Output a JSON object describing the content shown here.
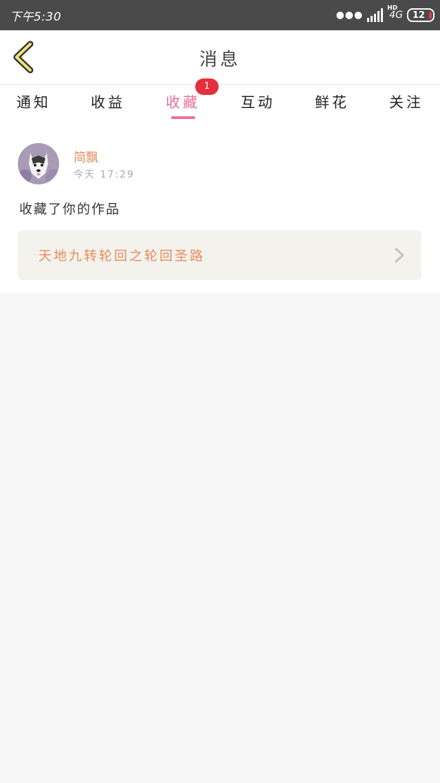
{
  "status_bar": {
    "time": "下午5:30",
    "hd_label": "HD",
    "network_label": "4G",
    "battery": "12"
  },
  "header": {
    "title": "消息"
  },
  "tabs": [
    {
      "label": "通知"
    },
    {
      "label": "收益"
    },
    {
      "label": "收藏",
      "active": true,
      "badge": "1"
    },
    {
      "label": "互动"
    },
    {
      "label": "鲜花"
    },
    {
      "label": "关注"
    }
  ],
  "notification": {
    "username": "简飘",
    "timestamp": "今天 17:29",
    "message": "收藏了你的作品",
    "work_title": "天地九转轮回之轮回圣路"
  },
  "colors": {
    "accent": "#e8709a",
    "badge": "#e5303c",
    "username": "#e98b5c",
    "card_bg": "#f3f2ec"
  }
}
